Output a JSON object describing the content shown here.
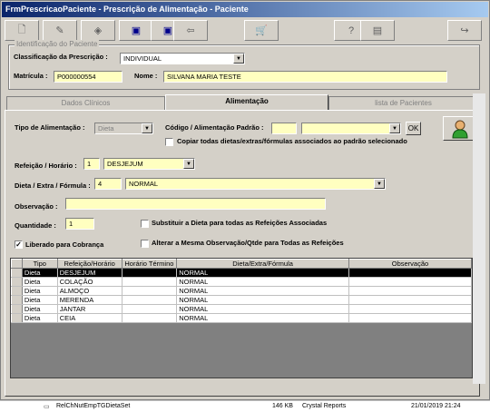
{
  "window": {
    "title": "FrmPrescricaoPaciente - Prescrição de Alimentação - Paciente"
  },
  "toolbar": {
    "buttons": [
      {
        "icon": "new-document-icon"
      },
      {
        "icon": "pencil-icon"
      },
      {
        "icon": "eraser-icon"
      },
      {
        "icon": "save-icon"
      },
      {
        "icon": "save-as-icon"
      },
      {
        "icon": "exit-door-icon"
      },
      {
        "icon": "cart-icon"
      },
      {
        "icon": "search-help-icon"
      },
      {
        "icon": "calculator-icon"
      },
      {
        "icon": "exit-icon"
      }
    ]
  },
  "patient": {
    "legend": "Identificação do Paciente",
    "classificacao_label": "Classificação da Prescrição :",
    "classificacao_value": "INDIVIDUAL",
    "matricula_label": "Matrícula :",
    "matricula_value": "P000000554",
    "nome_label": "Nome :",
    "nome_value": "SILVANA MARIA TESTE"
  },
  "tabs": [
    {
      "label": "Dados Clínicos"
    },
    {
      "label": "Alimentação"
    },
    {
      "label": "lista de Pacientes"
    }
  ],
  "alimentacao": {
    "tipo_label": "Tipo de Alimentação :",
    "tipo_value": "Dieta",
    "codigo_label": "Código / Alimentação Padrão :",
    "codigo_value": "",
    "padrao_value": "",
    "ok_label": "OK",
    "copiar_label": "Copiar todas dietas/extras/fórmulas associados ao padrão selecionado",
    "refeicao_label": "Refeição / Horário :",
    "refeicao_num": "1",
    "refeicao_value": "DESJEJUM",
    "dieta_label": "Dieta / Extra / Fórmula :",
    "dieta_num": "4",
    "dieta_value": "NORMAL",
    "observacao_label": "Observação :",
    "observacao_value": "",
    "quantidade_label": "Quantidade :",
    "quantidade_value": "1",
    "substituir_label": "Substituir a Dieta para todas as Refeições Associadas",
    "liberado_label": "Liberado para Cobrança",
    "liberado_checked": "✓",
    "alterar_label": "Alterar a Mesma Observação/Qtde para Todas as Refeições"
  },
  "grid": {
    "columns": [
      "Tipo",
      "Refeição/Horário",
      "Horário Término",
      "Dieta/Extra/Fórmula",
      "Observação"
    ],
    "rows": [
      [
        "Dieta",
        "DESJEJUM",
        "",
        "NORMAL",
        ""
      ],
      [
        "Dieta",
        "COLAÇÃO",
        "",
        "NORMAL",
        ""
      ],
      [
        "Dieta",
        "ALMOÇO",
        "",
        "NORMAL",
        ""
      ],
      [
        "Dieta",
        "MERENDA",
        "",
        "NORMAL",
        ""
      ],
      [
        "Dieta",
        "JANTAR",
        "",
        "NORMAL",
        ""
      ],
      [
        "Dieta",
        "CEIA",
        "",
        "NORMAL",
        ""
      ]
    ]
  },
  "taskbar": {
    "file": "RelChNutEmpTGDietaSet",
    "size": "146 KB",
    "type": "Crystal Reports",
    "date": "21/01/2019 21:24"
  }
}
